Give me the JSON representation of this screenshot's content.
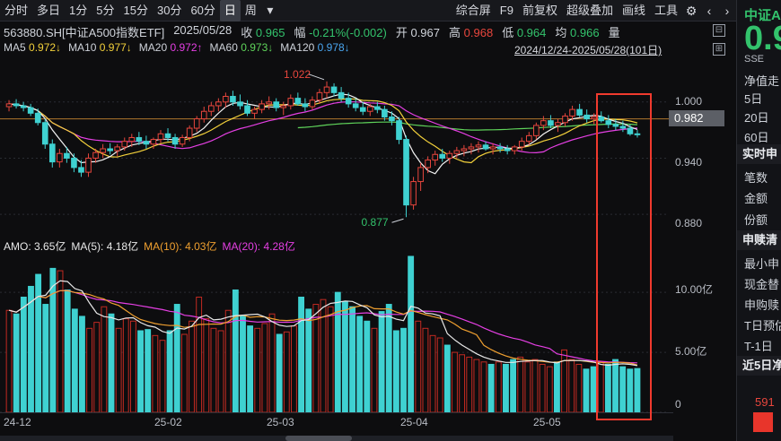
{
  "toolbar": {
    "periods": [
      "分时",
      "多日",
      "1分",
      "5分",
      "15分",
      "30分",
      "60分",
      "日",
      "周"
    ],
    "active_period": "日",
    "tools": [
      "综合屏",
      "F9",
      "前复权",
      "超级叠加",
      "画线",
      "工具"
    ],
    "icons": [
      "dropdown-icon",
      "gear-icon",
      "chevron-left-icon",
      "chevron-right-icon"
    ]
  },
  "quote": {
    "symbol": "563880.SH[中证A500指数ETF]",
    "date": "2025/05/28",
    "close_label": "收",
    "close": "0.965",
    "change_label": "幅",
    "change": "-0.21%(-0.002)",
    "open_label": "开",
    "open": "0.967",
    "high_label": "高",
    "high": "0.968",
    "low_label": "低",
    "low": "0.964",
    "cur_label": "均",
    "cur": "0.966",
    "vol_label": "量"
  },
  "ma_legend": {
    "ma5_label": "MA5",
    "ma5": "0.972↓",
    "ma10_label": "MA10",
    "ma10": "0.977↓",
    "ma20_label": "MA20",
    "ma20": "0.972↑",
    "ma60_label": "MA60",
    "ma60": "0.973↓",
    "ma120_label": "MA120",
    "ma120": "0.978↓",
    "range": "2024/12/24-2025/05/28(101日)"
  },
  "price_axis": {
    "labels": [
      "1.000",
      "0.940",
      "0.880"
    ],
    "current": "0.982"
  },
  "annotations": {
    "high": "1.022",
    "low": "0.877"
  },
  "volume_legend": {
    "amo_label": "AMO:",
    "amo": "3.65亿",
    "ma5_label": "MA(5):",
    "ma5": "4.18亿",
    "ma10_label": "MA(10):",
    "ma10": "4.03亿",
    "ma20_label": "MA(20):",
    "ma20": "4.28亿"
  },
  "volume_axis": {
    "labels": [
      "10.00亿",
      "5.00亿",
      "0"
    ]
  },
  "xaxis": {
    "labels": [
      "24-12",
      "25-02",
      "25-03",
      "25-04",
      "25-05"
    ]
  },
  "right_panel": {
    "title": "中证A",
    "price": "0.9",
    "code": "SSE",
    "sub_label": "净值走",
    "periods": [
      "5日",
      "20日",
      "60日"
    ],
    "section1": "实时申",
    "rows1": [
      "笔数",
      "金额",
      "份额"
    ],
    "section2": "申赎清",
    "rows2": [
      "最小申",
      "现金替",
      "申购赎",
      "T日预估",
      "T-1日",
      "近5日净"
    ],
    "inflow": "591"
  },
  "colors": {
    "up": "#e8463d",
    "down": "#33c36c",
    "ma5": "#f4f4f4",
    "ma10": "#f3d13b",
    "ma20": "#e53fe3",
    "ma60": "#5fd35a",
    "ma120": "#4aa6f0",
    "highlight": "#f03a2e"
  },
  "chart_data": [
    {
      "type": "candlestick",
      "title": "",
      "ylim": [
        0.86,
        1.04
      ],
      "yticks": [
        1.0,
        0.94,
        0.88
      ],
      "x_range": [
        "2024/12/24",
        "2025/05/28"
      ],
      "candles": [
        [
          0.995,
          1.002,
          0.99,
          0.998
        ],
        [
          0.998,
          1.003,
          0.993,
          0.996
        ],
        [
          0.996,
          1.0,
          0.99,
          0.994
        ],
        [
          0.994,
          0.998,
          0.985,
          0.988
        ],
        [
          0.988,
          0.993,
          0.975,
          0.978
        ],
        [
          0.978,
          0.982,
          0.95,
          0.955
        ],
        [
          0.955,
          0.96,
          0.93,
          0.936
        ],
        [
          0.936,
          0.95,
          0.93,
          0.945
        ],
        [
          0.945,
          0.952,
          0.935,
          0.94
        ],
        [
          0.94,
          0.945,
          0.925,
          0.93
        ],
        [
          0.93,
          0.938,
          0.92,
          0.925
        ],
        [
          0.925,
          0.945,
          0.92,
          0.94
        ],
        [
          0.94,
          0.95,
          0.935,
          0.946
        ],
        [
          0.946,
          0.955,
          0.94,
          0.95
        ],
        [
          0.95,
          0.956,
          0.944,
          0.948
        ],
        [
          0.948,
          0.955,
          0.942,
          0.952
        ],
        [
          0.952,
          0.962,
          0.948,
          0.958
        ],
        [
          0.958,
          0.966,
          0.952,
          0.962
        ],
        [
          0.962,
          0.968,
          0.954,
          0.958
        ],
        [
          0.958,
          0.964,
          0.95,
          0.955
        ],
        [
          0.955,
          0.962,
          0.95,
          0.96
        ],
        [
          0.96,
          0.97,
          0.956,
          0.966
        ],
        [
          0.966,
          0.972,
          0.958,
          0.962
        ],
        [
          0.962,
          0.966,
          0.95,
          0.955
        ],
        [
          0.955,
          0.965,
          0.952,
          0.962
        ],
        [
          0.962,
          0.975,
          0.958,
          0.972
        ],
        [
          0.972,
          0.985,
          0.968,
          0.982
        ],
        [
          0.982,
          0.995,
          0.978,
          0.99
        ],
        [
          0.99,
          1.0,
          0.985,
          0.996
        ],
        [
          0.996,
          1.004,
          0.99,
          1.0
        ],
        [
          1.0,
          1.01,
          0.994,
          1.006
        ],
        [
          1.006,
          1.012,
          0.996,
          1.0
        ],
        [
          1.0,
          1.008,
          0.992,
          0.996
        ],
        [
          0.996,
          1.002,
          0.985,
          0.988
        ],
        [
          0.988,
          0.995,
          0.982,
          0.992
        ],
        [
          0.992,
          1.002,
          0.988,
          0.998
        ],
        [
          0.998,
          1.006,
          0.992,
          1.0
        ],
        [
          1.0,
          1.004,
          0.99,
          0.994
        ],
        [
          0.994,
          1.0,
          0.986,
          0.996
        ],
        [
          0.996,
          1.008,
          0.992,
          1.004
        ],
        [
          1.004,
          1.01,
          0.996,
          0.998
        ],
        [
          0.998,
          1.004,
          0.99,
          0.995
        ],
        [
          0.995,
          1.006,
          0.992,
          1.002
        ],
        [
          1.002,
          1.014,
          0.998,
          1.01
        ],
        [
          1.01,
          1.022,
          1.004,
          1.016
        ],
        [
          1.016,
          1.02,
          1.006,
          1.01
        ],
        [
          1.01,
          1.016,
          1.0,
          1.004
        ],
        [
          1.004,
          1.01,
          0.994,
          0.998
        ],
        [
          0.998,
          1.004,
          0.99,
          0.994
        ],
        [
          0.994,
          1.0,
          0.986,
          0.99
        ],
        [
          0.99,
          0.998,
          0.985,
          0.995
        ],
        [
          0.995,
          1.0,
          0.988,
          0.992
        ],
        [
          0.992,
          0.996,
          0.98,
          0.984
        ],
        [
          0.984,
          0.99,
          0.975,
          0.98
        ],
        [
          0.98,
          0.984,
          0.955,
          0.96
        ],
        [
          0.96,
          0.964,
          0.877,
          0.89
        ],
        [
          0.89,
          0.92,
          0.885,
          0.915
        ],
        [
          0.915,
          0.935,
          0.905,
          0.93
        ],
        [
          0.93,
          0.942,
          0.924,
          0.938
        ],
        [
          0.938,
          0.948,
          0.932,
          0.944
        ],
        [
          0.944,
          0.95,
          0.936,
          0.94
        ],
        [
          0.94,
          0.948,
          0.934,
          0.945
        ],
        [
          0.945,
          0.952,
          0.94,
          0.948
        ],
        [
          0.948,
          0.954,
          0.942,
          0.95
        ],
        [
          0.95,
          0.956,
          0.944,
          0.952
        ],
        [
          0.952,
          0.958,
          0.946,
          0.954
        ],
        [
          0.954,
          0.958,
          0.948,
          0.95
        ],
        [
          0.95,
          0.956,
          0.944,
          0.952
        ],
        [
          0.952,
          0.956,
          0.946,
          0.95
        ],
        [
          0.95,
          0.954,
          0.944,
          0.948
        ],
        [
          0.948,
          0.954,
          0.944,
          0.952
        ],
        [
          0.952,
          0.962,
          0.948,
          0.958
        ],
        [
          0.958,
          0.968,
          0.954,
          0.964
        ],
        [
          0.964,
          0.978,
          0.96,
          0.975
        ],
        [
          0.975,
          0.985,
          0.97,
          0.98
        ],
        [
          0.98,
          0.986,
          0.972,
          0.975
        ],
        [
          0.975,
          0.982,
          0.968,
          0.978
        ],
        [
          0.978,
          0.988,
          0.974,
          0.985
        ],
        [
          0.985,
          0.996,
          0.98,
          0.992
        ],
        [
          0.992,
          0.998,
          0.984,
          0.986
        ],
        [
          0.986,
          0.992,
          0.978,
          0.982
        ],
        [
          0.982,
          0.988,
          0.976,
          0.984
        ],
        [
          0.984,
          0.99,
          0.978,
          0.98
        ],
        [
          0.98,
          0.986,
          0.972,
          0.976
        ],
        [
          0.976,
          0.982,
          0.97,
          0.974
        ],
        [
          0.974,
          0.98,
          0.968,
          0.972
        ],
        [
          0.972,
          0.976,
          0.964,
          0.966
        ],
        [
          0.966,
          0.97,
          0.962,
          0.965
        ]
      ]
    },
    {
      "type": "bar",
      "title": "",
      "ylim": [
        0,
        13
      ],
      "yticks": [
        10,
        5,
        0
      ],
      "values": [
        8.5,
        8.2,
        9.6,
        10.5,
        11.5,
        9.0,
        12.0,
        11.8,
        10.2,
        8.6,
        8.0,
        7.0,
        7.5,
        8.8,
        8.2,
        7.0,
        7.8,
        7.6,
        6.8,
        6.9,
        6.4,
        6.0,
        6.8,
        9.0,
        6.5,
        7.6,
        9.6,
        7.8,
        7.0,
        6.8,
        8.5,
        10.2,
        8.0,
        7.2,
        7.0,
        7.4,
        8.2,
        6.5,
        6.7,
        7.2,
        9.6,
        8.6,
        9.0,
        9.4,
        8.8,
        10.0,
        9.2,
        8.8,
        8.0,
        7.6,
        7.0,
        8.4,
        9.0,
        6.8,
        7.0,
        13.0,
        7.6,
        7.0,
        6.4,
        6.2,
        5.6,
        5.0,
        4.8,
        4.6,
        4.4,
        4.2,
        4.0,
        4.2,
        4.0,
        4.4,
        4.6,
        4.2,
        4.4,
        4.0,
        3.8,
        4.2,
        5.2,
        4.4,
        4.0,
        3.6,
        3.8,
        4.2,
        4.0,
        4.4,
        3.8,
        3.6,
        3.65
      ],
      "up_down": "alternating",
      "ma5_line": "descending",
      "ma10_line": "descending",
      "ma20_line": "descending"
    }
  ]
}
